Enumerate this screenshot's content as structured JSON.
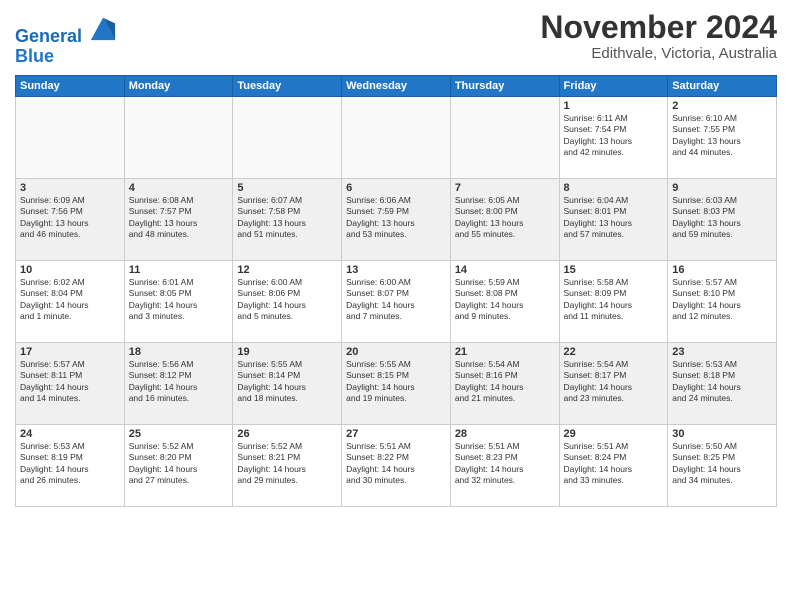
{
  "header": {
    "logo_line1": "General",
    "logo_line2": "Blue",
    "month": "November 2024",
    "location": "Edithvale, Victoria, Australia"
  },
  "weekdays": [
    "Sunday",
    "Monday",
    "Tuesday",
    "Wednesday",
    "Thursday",
    "Friday",
    "Saturday"
  ],
  "weeks": [
    [
      {
        "day": "",
        "info": ""
      },
      {
        "day": "",
        "info": ""
      },
      {
        "day": "",
        "info": ""
      },
      {
        "day": "",
        "info": ""
      },
      {
        "day": "",
        "info": ""
      },
      {
        "day": "1",
        "info": "Sunrise: 6:11 AM\nSunset: 7:54 PM\nDaylight: 13 hours\nand 42 minutes."
      },
      {
        "day": "2",
        "info": "Sunrise: 6:10 AM\nSunset: 7:55 PM\nDaylight: 13 hours\nand 44 minutes."
      }
    ],
    [
      {
        "day": "3",
        "info": "Sunrise: 6:09 AM\nSunset: 7:56 PM\nDaylight: 13 hours\nand 46 minutes."
      },
      {
        "day": "4",
        "info": "Sunrise: 6:08 AM\nSunset: 7:57 PM\nDaylight: 13 hours\nand 48 minutes."
      },
      {
        "day": "5",
        "info": "Sunrise: 6:07 AM\nSunset: 7:58 PM\nDaylight: 13 hours\nand 51 minutes."
      },
      {
        "day": "6",
        "info": "Sunrise: 6:06 AM\nSunset: 7:59 PM\nDaylight: 13 hours\nand 53 minutes."
      },
      {
        "day": "7",
        "info": "Sunrise: 6:05 AM\nSunset: 8:00 PM\nDaylight: 13 hours\nand 55 minutes."
      },
      {
        "day": "8",
        "info": "Sunrise: 6:04 AM\nSunset: 8:01 PM\nDaylight: 13 hours\nand 57 minutes."
      },
      {
        "day": "9",
        "info": "Sunrise: 6:03 AM\nSunset: 8:03 PM\nDaylight: 13 hours\nand 59 minutes."
      }
    ],
    [
      {
        "day": "10",
        "info": "Sunrise: 6:02 AM\nSunset: 8:04 PM\nDaylight: 14 hours\nand 1 minute."
      },
      {
        "day": "11",
        "info": "Sunrise: 6:01 AM\nSunset: 8:05 PM\nDaylight: 14 hours\nand 3 minutes."
      },
      {
        "day": "12",
        "info": "Sunrise: 6:00 AM\nSunset: 8:06 PM\nDaylight: 14 hours\nand 5 minutes."
      },
      {
        "day": "13",
        "info": "Sunrise: 6:00 AM\nSunset: 8:07 PM\nDaylight: 14 hours\nand 7 minutes."
      },
      {
        "day": "14",
        "info": "Sunrise: 5:59 AM\nSunset: 8:08 PM\nDaylight: 14 hours\nand 9 minutes."
      },
      {
        "day": "15",
        "info": "Sunrise: 5:58 AM\nSunset: 8:09 PM\nDaylight: 14 hours\nand 11 minutes."
      },
      {
        "day": "16",
        "info": "Sunrise: 5:57 AM\nSunset: 8:10 PM\nDaylight: 14 hours\nand 12 minutes."
      }
    ],
    [
      {
        "day": "17",
        "info": "Sunrise: 5:57 AM\nSunset: 8:11 PM\nDaylight: 14 hours\nand 14 minutes."
      },
      {
        "day": "18",
        "info": "Sunrise: 5:56 AM\nSunset: 8:12 PM\nDaylight: 14 hours\nand 16 minutes."
      },
      {
        "day": "19",
        "info": "Sunrise: 5:55 AM\nSunset: 8:14 PM\nDaylight: 14 hours\nand 18 minutes."
      },
      {
        "day": "20",
        "info": "Sunrise: 5:55 AM\nSunset: 8:15 PM\nDaylight: 14 hours\nand 19 minutes."
      },
      {
        "day": "21",
        "info": "Sunrise: 5:54 AM\nSunset: 8:16 PM\nDaylight: 14 hours\nand 21 minutes."
      },
      {
        "day": "22",
        "info": "Sunrise: 5:54 AM\nSunset: 8:17 PM\nDaylight: 14 hours\nand 23 minutes."
      },
      {
        "day": "23",
        "info": "Sunrise: 5:53 AM\nSunset: 8:18 PM\nDaylight: 14 hours\nand 24 minutes."
      }
    ],
    [
      {
        "day": "24",
        "info": "Sunrise: 5:53 AM\nSunset: 8:19 PM\nDaylight: 14 hours\nand 26 minutes."
      },
      {
        "day": "25",
        "info": "Sunrise: 5:52 AM\nSunset: 8:20 PM\nDaylight: 14 hours\nand 27 minutes."
      },
      {
        "day": "26",
        "info": "Sunrise: 5:52 AM\nSunset: 8:21 PM\nDaylight: 14 hours\nand 29 minutes."
      },
      {
        "day": "27",
        "info": "Sunrise: 5:51 AM\nSunset: 8:22 PM\nDaylight: 14 hours\nand 30 minutes."
      },
      {
        "day": "28",
        "info": "Sunrise: 5:51 AM\nSunset: 8:23 PM\nDaylight: 14 hours\nand 32 minutes."
      },
      {
        "day": "29",
        "info": "Sunrise: 5:51 AM\nSunset: 8:24 PM\nDaylight: 14 hours\nand 33 minutes."
      },
      {
        "day": "30",
        "info": "Sunrise: 5:50 AM\nSunset: 8:25 PM\nDaylight: 14 hours\nand 34 minutes."
      }
    ]
  ]
}
